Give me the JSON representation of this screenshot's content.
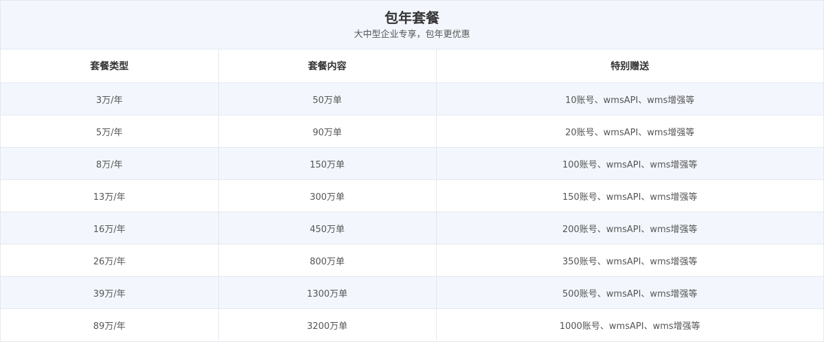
{
  "header": {
    "title": "包年套餐",
    "subtitle": "大中型企业专享，包年更优惠"
  },
  "table": {
    "columns": [
      "套餐类型",
      "套餐内容",
      "特别赠送"
    ],
    "rows": [
      [
        "3万/年",
        "50万单",
        "10账号、wmsAPI、wms增强等"
      ],
      [
        "5万/年",
        "90万单",
        "20账号、wmsAPI、wms增强等"
      ],
      [
        "8万/年",
        "150万单",
        "100账号、wmsAPI、wms增强等"
      ],
      [
        "13万/年",
        "300万单",
        "150账号、wmsAPI、wms增强等"
      ],
      [
        "16万/年",
        "450万单",
        "200账号、wmsAPI、wms增强等"
      ],
      [
        "26万/年",
        "800万单",
        "350账号、wmsAPI、wms增强等"
      ],
      [
        "39万/年",
        "1300万单",
        "500账号、wmsAPI、wms增强等"
      ],
      [
        "89万/年",
        "3200万单",
        "1000账号、wmsAPI、wms增强等"
      ]
    ]
  },
  "colors": {
    "header_bg": "#f3f7fd",
    "row_alt_bg": "#f3f7fd",
    "border": "#e3e8ef",
    "title_text": "#333333",
    "body_text": "#555555"
  }
}
